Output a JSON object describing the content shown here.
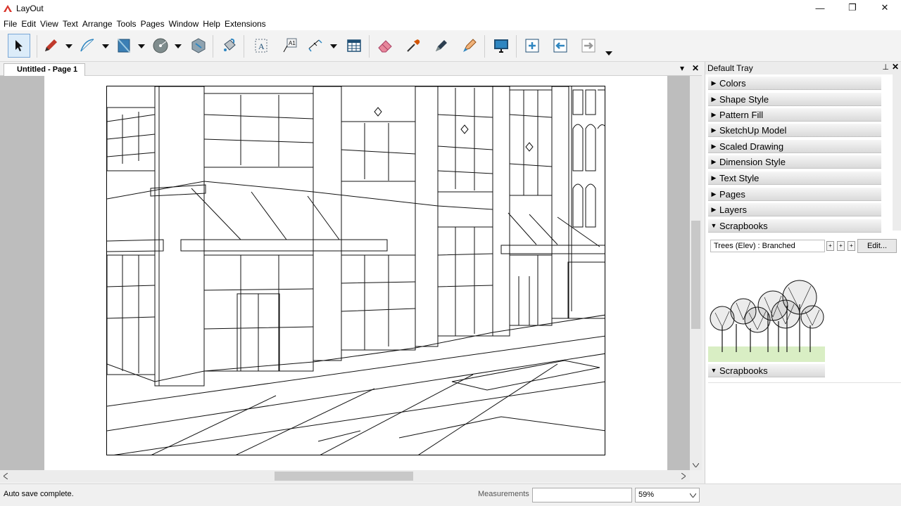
{
  "window": {
    "title": "LayOut",
    "controls": {
      "minimize": "—",
      "maximize": "❐",
      "close": "✕"
    }
  },
  "menu": [
    "File",
    "Edit",
    "View",
    "Text",
    "Arrange",
    "Tools",
    "Pages",
    "Window",
    "Help",
    "Extensions"
  ],
  "toolbar": {
    "tools": [
      "select",
      "pencil",
      "arc",
      "rectangle",
      "circle",
      "polygon",
      "paint-bucket",
      "text",
      "label",
      "dimension",
      "table",
      "eraser",
      "eyedropper",
      "split",
      "style",
      "presentation",
      "add-page",
      "previous-page",
      "next-page"
    ],
    "active": "select"
  },
  "document": {
    "tab_label": "Untitled - Page 1",
    "tab_dropdown": "▾",
    "tab_close": "✕"
  },
  "status": {
    "message": "Auto save complete.",
    "measurements_label": "Measurements",
    "measurements_value": "",
    "zoom": "59%"
  },
  "tray": {
    "title": "Default Tray",
    "pin": "⊥",
    "close": "✕",
    "panels": [
      "Colors",
      "Shape Style",
      "Pattern Fill",
      "SketchUp Model",
      "Scaled Drawing",
      "Dimension Style",
      "Text Style",
      "Pages",
      "Layers",
      "Scrapbooks"
    ],
    "scrapbook": {
      "selected": "Trees (Elev) : Branched",
      "edit_label": "Edit...",
      "footer_panel": "Scrapbooks"
    }
  },
  "colors": {
    "accent_highlight": "#dcecf9",
    "grass": "#d9eec4",
    "canvas_bg": "#bdbdbd"
  }
}
